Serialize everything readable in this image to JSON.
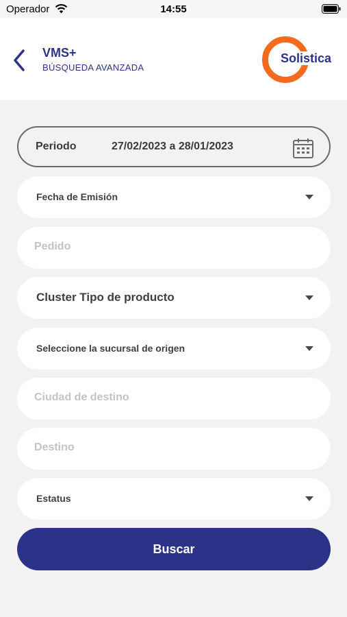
{
  "status_bar": {
    "carrier": "Operador",
    "time": "14:55"
  },
  "header": {
    "title": "VMS+",
    "subtitle": "BÚSQUEDA AVANZADA",
    "logo_text": "Solistica"
  },
  "period": {
    "label": "Periodo",
    "value": "27/02/2023 a 28/01/2023"
  },
  "fields": {
    "fecha_emision": "Fecha de Emisión",
    "pedido_placeholder": "Pedido",
    "cluster": "Cluster Tipo de producto",
    "sucursal": "Seleccione la sucursal de origen",
    "ciudad_placeholder": "Ciudad de destino",
    "destino_placeholder": "Destino",
    "estatus": "Estatus"
  },
  "actions": {
    "search_label": "Buscar"
  },
  "colors": {
    "brand_blue": "#2b3388",
    "brand_orange": "#f26b1e",
    "background": "#f2f2f3"
  }
}
